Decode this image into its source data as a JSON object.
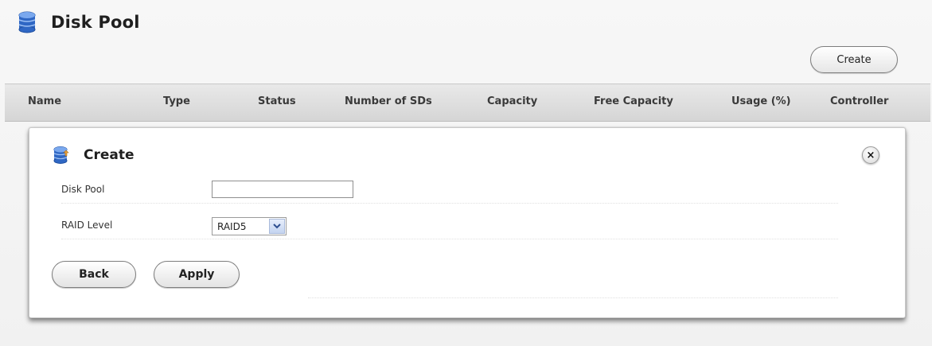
{
  "header": {
    "title": "Disk Pool",
    "icon": "database-icon"
  },
  "toolbar": {
    "create_label": "Create"
  },
  "table": {
    "columns": [
      "Name",
      "Type",
      "Status",
      "Number of SDs",
      "Capacity",
      "Free Capacity",
      "Usage (%)",
      "Controller"
    ]
  },
  "dialog": {
    "title": "Create",
    "icon": "database-add-icon",
    "close_label": "×",
    "fields": {
      "disk_pool_label": "Disk Pool",
      "disk_pool_value": "",
      "raid_level_label": "RAID Level",
      "raid_level_value": "RAID5"
    },
    "back_label": "Back",
    "apply_label": "Apply"
  },
  "colors": {
    "icon_blue": "#2f67c4",
    "icon_accent": "#e8a13a",
    "table_header_bg": "#dcdcdc"
  }
}
